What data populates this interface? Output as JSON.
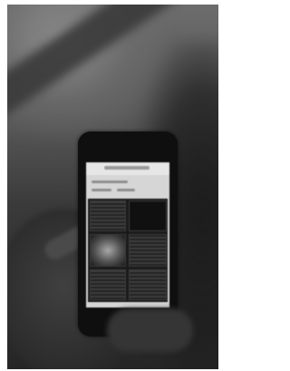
{
  "photo": {
    "subject": "hand-holding-smartphone",
    "palette": {
      "background": "#ffffff",
      "wall": "#6c6c6c",
      "shadow": "#262626",
      "phone": "#0f0f0f",
      "screen": "#d6d6d6"
    }
  }
}
